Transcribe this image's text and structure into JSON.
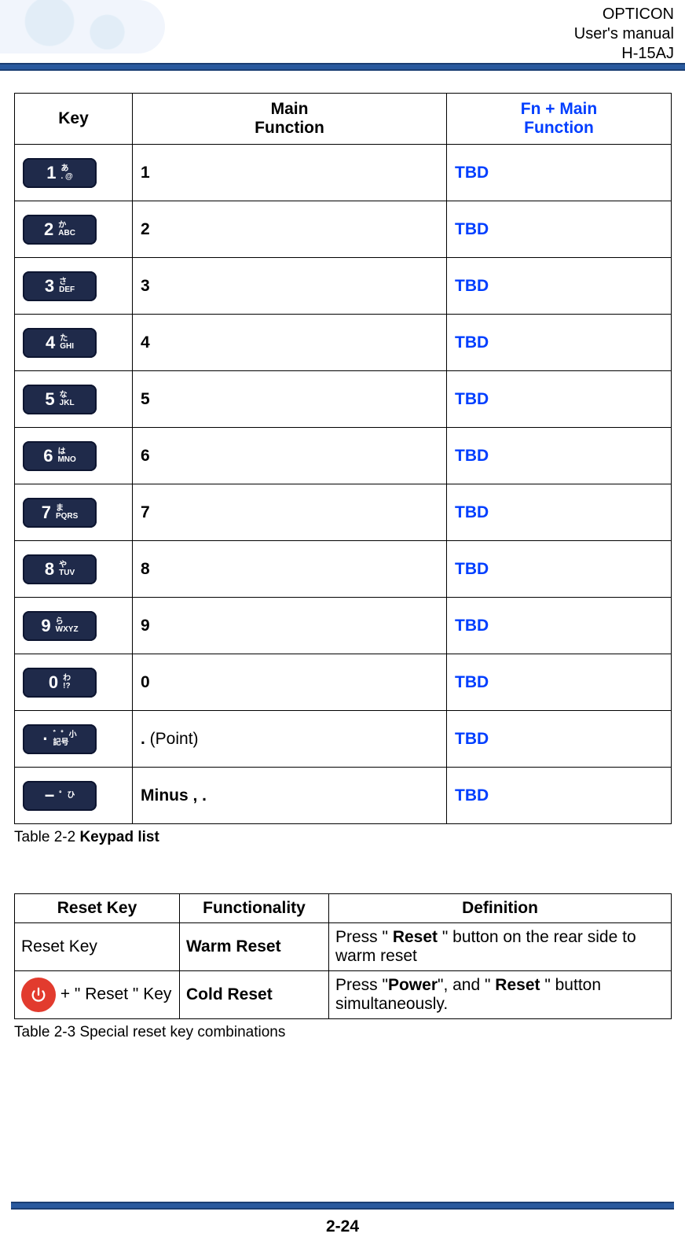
{
  "header": {
    "brand": "OPTICON",
    "doc": "User's manual",
    "model": "H-15AJ"
  },
  "table1": {
    "headers": {
      "key": "Key",
      "main_l1": "Main",
      "main_l2": "Function",
      "fn_l1": "Fn + Main",
      "fn_l2": "Function"
    },
    "rows": [
      {
        "glyph_main": "1",
        "glyph_sub_top": "あ",
        "glyph_sub_bot": ". @",
        "main": "1",
        "fn": "TBD"
      },
      {
        "glyph_main": "2",
        "glyph_sub_top": "か",
        "glyph_sub_bot": "ABC",
        "main": "2",
        "fn": "TBD"
      },
      {
        "glyph_main": "3",
        "glyph_sub_top": "さ",
        "glyph_sub_bot": "DEF",
        "main": "3",
        "fn": "TBD"
      },
      {
        "glyph_main": "4",
        "glyph_sub_top": "た",
        "glyph_sub_bot": "GHI",
        "main": "4",
        "fn": "TBD"
      },
      {
        "glyph_main": "5",
        "glyph_sub_top": "な",
        "glyph_sub_bot": "JKL",
        "main": "5",
        "fn": "TBD"
      },
      {
        "glyph_main": "6",
        "glyph_sub_top": "は",
        "glyph_sub_bot": "MNO",
        "main": "6",
        "fn": "TBD"
      },
      {
        "glyph_main": "7",
        "glyph_sub_top": "ま",
        "glyph_sub_bot": "PQRS",
        "main": "7",
        "fn": "TBD"
      },
      {
        "glyph_main": "8",
        "glyph_sub_top": "や",
        "glyph_sub_bot": "TUV",
        "main": "8",
        "fn": "TBD"
      },
      {
        "glyph_main": "9",
        "glyph_sub_top": "ら",
        "glyph_sub_bot": "WXYZ",
        "main": "9",
        "fn": "TBD"
      },
      {
        "glyph_main": "0",
        "glyph_sub_top": "わ",
        "glyph_sub_bot": "!?",
        "main": "0",
        "fn": "TBD"
      },
      {
        "glyph_main": "·",
        "glyph_sub_top": "゛゜小",
        "glyph_sub_bot": "記号",
        "main_bold": ".",
        "main_rest": " (Point)",
        "fn": "TBD"
      },
      {
        "glyph_main": "−",
        "glyph_sub_top": "",
        "glyph_sub_bot": "゜ひ",
        "main": "Minus , .",
        "fn": "TBD"
      }
    ],
    "caption_prefix": "Table 2-2 ",
    "caption_bold": "Keypad list"
  },
  "table2": {
    "headers": {
      "c1": "Reset Key",
      "c2": "Functionality",
      "c3": "Definition"
    },
    "rows": [
      {
        "c1": "Reset Key",
        "c2": "Warm Reset",
        "c3_pre": "Press \" ",
        "c3_b1": "Reset",
        "c3_post": " \" button on the rear side to warm reset"
      },
      {
        "c1_pre": " + \" Reset \" Key",
        "c2": "Cold Reset",
        "c3_pre": "Press \"",
        "c3_b1": "Power",
        "c3_mid": "\", and \" ",
        "c3_b2": "Reset",
        "c3_post": " \" button simultaneously."
      }
    ],
    "caption": "Table 2-3 Special reset key combinations"
  },
  "footer": {
    "page": "2-24"
  }
}
